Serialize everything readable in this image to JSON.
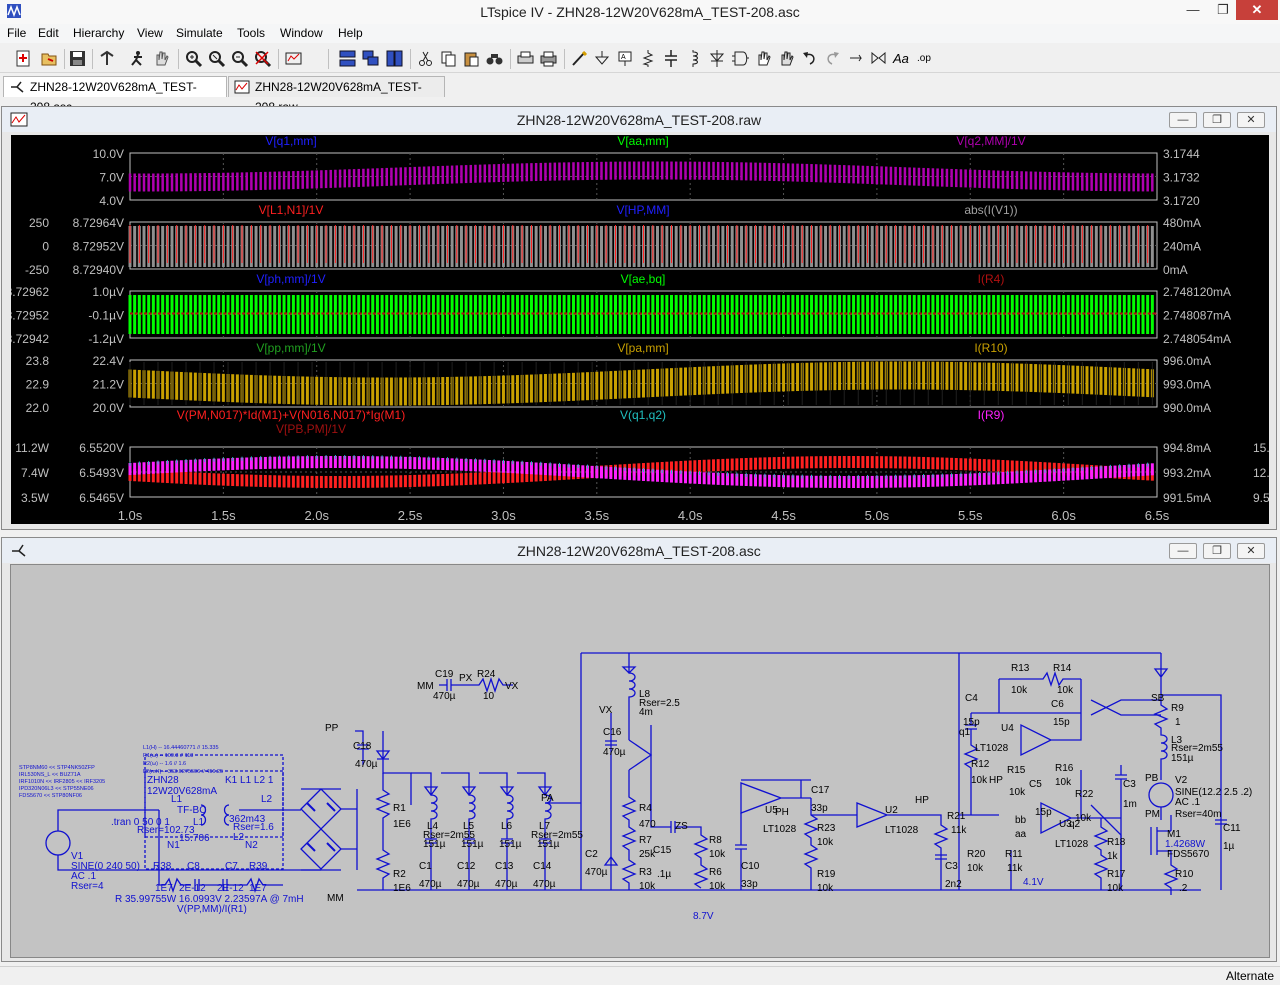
{
  "window": {
    "title": "LTspice IV - ZHN28-12W20V628mA_TEST-208.asc",
    "min": "—",
    "max": "❐",
    "close": "✕"
  },
  "menu": [
    "File",
    "Edit",
    "Hierarchy",
    "View",
    "Simulate",
    "Tools",
    "Window",
    "Help"
  ],
  "tabs": [
    {
      "label": "ZHN28-12W20V628mA_TEST-208.asc",
      "active": true
    },
    {
      "label": "ZHN28-12W20V628mA_TEST-208.raw",
      "active": false
    }
  ],
  "waveform_window": {
    "title": "ZHN28-12W20V628mA_TEST-208.raw",
    "panes": [
      {
        "traces": [
          {
            "label": "V[q1,mm]",
            "color": "#2020ff"
          },
          {
            "label": "V[aa,mm]",
            "color": "#00ff00"
          },
          {
            "label": "V[q2,MM]/1V",
            "color": "#b000b0"
          }
        ],
        "left_ticks": [
          "10.0V",
          "7.0V",
          "4.0V"
        ],
        "left2_ticks": [],
        "right_ticks": [
          "3.1744",
          "3.1732",
          "3.1720"
        ],
        "right2_ticks": []
      },
      {
        "traces": [
          {
            "label": "V[L1,N1]/1V",
            "color": "#ff2020"
          },
          {
            "label": "V[HP,MM]",
            "color": "#2020ff"
          },
          {
            "label": "abs(I(V1))",
            "color": "#a0a0a0"
          }
        ],
        "left_ticks": [
          "8.72964V",
          "8.72952V",
          "8.72940V"
        ],
        "left2_ticks": [
          "250",
          "0",
          "-250"
        ],
        "right_ticks": [
          "480mA",
          "240mA",
          "0mA"
        ],
        "right2_ticks": []
      },
      {
        "traces": [
          {
            "label": "V[ph,mm]/1V",
            "color": "#2020ff"
          },
          {
            "label": "V[ae,bq]",
            "color": "#00ff00"
          },
          {
            "label": "I(R4)",
            "color": "#b01010"
          }
        ],
        "left_ticks": [
          "1.0µV",
          "-0.1µV",
          "-1.2µV"
        ],
        "left2_ticks": [
          "8.72962",
          "8.72952",
          "8.72942"
        ],
        "right_ticks": [
          "2.748120mA",
          "2.748087mA",
          "2.748054mA"
        ],
        "right2_ticks": []
      },
      {
        "traces": [
          {
            "label": "V[pp,mm]/1V",
            "color": "#20a020"
          },
          {
            "label": "V[pa,mm]",
            "color": "#c8a000"
          },
          {
            "label": "I(R10)",
            "color": "#c8a000"
          }
        ],
        "left_ticks": [
          "22.4V",
          "21.2V",
          "20.0V"
        ],
        "left2_ticks": [
          "23.8",
          "22.9",
          "22.0"
        ],
        "right_ticks": [
          "996.0mA",
          "993.0mA",
          "990.0mA"
        ],
        "right2_ticks": []
      },
      {
        "traces": [
          {
            "label": "V(PM,N017)*Id(M1)+V(N016,N017)*Ig(M1)",
            "color": "#ff2020"
          },
          {
            "label": "V(q1,q2)",
            "color": "#20c0c0"
          },
          {
            "label": "I(R9)",
            "color": "#ff20ff"
          },
          {
            "label": "V[PB,PM]/1V",
            "color": "#a01010"
          }
        ],
        "left_ticks": [
          "6.5520V",
          "6.5493V",
          "6.5465V"
        ],
        "left2_ticks": [
          "11.2W",
          "7.4W",
          "3.5W"
        ],
        "right_ticks": [
          "994.8mA",
          "993.2mA",
          "991.5mA"
        ],
        "right2_ticks": [
          "15.0",
          "12.3",
          "9.5"
        ]
      }
    ],
    "x_ticks": [
      "1.0s",
      "1.5s",
      "2.0s",
      "2.5s",
      "3.0s",
      "3.5s",
      "4.0s",
      "4.5s",
      "5.0s",
      "5.5s",
      "6.0s",
      "6.5s"
    ]
  },
  "schematic_window": {
    "title": "ZHN28-12W20V628mA_TEST-208.asc",
    "labels": {
      "tran": ".tran 0 50 0 1",
      "v1_name": "V1",
      "v1_value": "SINE(0 240 50)",
      "v1_ac": "AC .1",
      "v1_rser": "Rser=4",
      "zhn": "ZHN28",
      "zhn_sub": "12W20V628mA",
      "tfbc": "TF-BC",
      "l1": "L1",
      "l2": "L2",
      "n1": "N1",
      "n2": "N2",
      "k1": "K1 L1 L2 1",
      "rser102": "Rser=102.73",
      "v15706": "15.706",
      "v362": "362m43",
      "rser16": "Rser=1.6",
      "r38": "R38",
      "c8": "C8",
      "c7": "C7",
      "r39": "R39",
      "v1e7a": "1E7",
      "v2e12a": "2E-12",
      "v2e12b": "2E-12",
      "v1e7b": "1E7",
      "meas1": "R 35.99755W 16.0993V 2.23597A @ 7mH",
      "meas2": "V(PP,MM)/I(R1)",
      "note1": "STP8NM60 << STP4NK50ZFP",
      "note2": "IRL530NS_L << BUZ71A",
      "note3": "IRF1010N << IRF2805 << IRF3205",
      "note4": "IPD320N06L3 << STP55NE06",
      "note5": "FDS5670 << STP80NF06",
      "note6": "L1(H) -- 16.44460771 // 15.335",
      "note7": "R1(ω) -- 109.8 // 113",
      "note8": "R2(ω) -- 1.6 // 1.6",
      "note9": "L2(mH) -- 353.0275506 // 456.25",
      "pp": "PP",
      "c18": "C18",
      "c18v": "470µ",
      "r1": "R1",
      "r1v": "1E6",
      "r2": "R2",
      "r2v": "1E6",
      "mm": "MM",
      "l4": "L4",
      "l5": "L5",
      "l6": "L6",
      "l7": "L7",
      "rser2m55": "Rser=2m55",
      "v151": "151µ",
      "c1": "C1",
      "c12": "C12",
      "c13": "C13",
      "c14": "C14",
      "v470": "470µ",
      "pa": "PA",
      "c19": "C19",
      "px": "PX",
      "r24": "R24",
      "vx": "VX",
      "c19v": "470µ",
      "r24v": "10",
      "l8": "L8",
      "l8r": "Rser=2.5",
      "l8v": "4m",
      "vx2": "VX",
      "c16": "C16",
      "c16v": "470µ",
      "r4": "R4",
      "r4v": "470",
      "r7": "R7",
      "r7v": "25k",
      "r3": "R3",
      "r3v": "10k",
      "c15": "C15",
      "c15v": ".1µ",
      "zs": "ZS",
      "c2": "C2",
      "c2v": "470µ",
      "r8": "R8",
      "r8v": "10k",
      "r6": "R6",
      "r6v": "10k",
      "v87": "8.7V",
      "u5": "U5",
      "lt1028": "LT1028",
      "ph": "PH",
      "c17": "C17",
      "c17v": "33p",
      "r23": "R23",
      "r23v": "10k",
      "c10": "C10",
      "c10v": "33p",
      "r19": "R19",
      "r19v": "10k",
      "u2": "U2",
      "hp": "HP",
      "r21": "R21",
      "r21v": "11k",
      "c3": "C3",
      "c3v": "2n2",
      "r20": "R20",
      "r20v": "10k",
      "r11": "R11",
      "r11v": "11k",
      "v41": "4.1V",
      "c4": "C4",
      "c4v": "15p",
      "q1": "q1",
      "r12": "R12",
      "r12v": "10k",
      "r13": "R13",
      "r13v": "10k",
      "r14": "R14",
      "r14v": "10k",
      "u4": "U4",
      "c6": "C6",
      "c6v": "15p",
      "r16": "R16",
      "r16v": "10k",
      "r15": "R15",
      "r15v": "10k",
      "c5": "C5",
      "c5v": "15p",
      "bb": "bb",
      "u3": "U3",
      "q2": "q2",
      "aa": "aa",
      "r22": "R22",
      "r22v": "10k",
      "sb": "SB",
      "r9": "R9",
      "r9v": "1",
      "l3": "L3",
      "l3r": "Rser=2m55",
      "l3v": "151µ",
      "c3b": "C3",
      "c3bv": "1m",
      "pb": "PB",
      "v2": "V2",
      "v2v": "SINE(12.2 2.5 .2)",
      "v2ac": "AC .1",
      "v2r": "Rser=40m",
      "pm": "PM",
      "m1": "M1",
      "m1v": "FDS5670",
      "pw": "1.4268W",
      "r18": "R18",
      "r18v": "1k",
      "r17": "R17",
      "r17v": "10k",
      "r10": "R10",
      "r10v": ".2",
      "c11": "C11",
      "c11v": "1µ"
    }
  },
  "status": "Alternate"
}
